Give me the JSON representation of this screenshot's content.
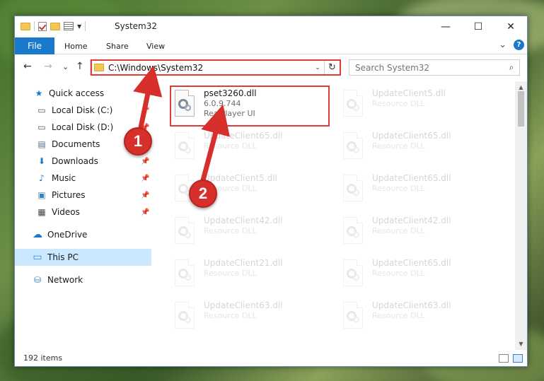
{
  "window": {
    "title": "System32",
    "minimize_glyph": "—",
    "maximize_glyph": "☐",
    "close_glyph": "✕"
  },
  "ribbon": {
    "tabs": [
      "File",
      "Home",
      "Share",
      "View"
    ],
    "expand_glyph": "⌄",
    "help_glyph": "?"
  },
  "navigation": {
    "back_glyph": "←",
    "forward_glyph": "→",
    "recent_glyph": "⌄",
    "up_glyph": "↑",
    "address": "C:\\Windows\\System32",
    "address_dropdown_glyph": "⌄",
    "refresh_glyph": "↻",
    "search_placeholder": "Search System32",
    "search_icon_glyph": "⌕"
  },
  "sidebar": {
    "items": [
      {
        "label": "Quick access",
        "icon": "star-icon",
        "glyph": "★",
        "color": "#1979ca"
      },
      {
        "label": "Local Disk (C:)",
        "icon": "drive-icon",
        "glyph": "▭",
        "color": "#555555"
      },
      {
        "label": "Local Disk (D:)",
        "icon": "drive-icon",
        "glyph": "▭",
        "color": "#555555"
      },
      {
        "label": "Documents",
        "icon": "document-icon",
        "glyph": "▤",
        "color": "#5a6f86"
      },
      {
        "label": "Downloads",
        "icon": "download-icon",
        "glyph": "⬇",
        "color": "#1979ca"
      },
      {
        "label": "Music",
        "icon": "music-icon",
        "glyph": "♪",
        "color": "#1979ca"
      },
      {
        "label": "Pictures",
        "icon": "picture-icon",
        "glyph": "▣",
        "color": "#3c7fb8"
      },
      {
        "label": "Videos",
        "icon": "video-icon",
        "glyph": "▦",
        "color": "#444444"
      },
      {
        "label": "OneDrive",
        "icon": "cloud-icon",
        "glyph": "☁",
        "color": "#1979ca"
      },
      {
        "label": "This PC",
        "icon": "computer-icon",
        "glyph": "▭",
        "color": "#3a8ad6"
      },
      {
        "label": "Network",
        "icon": "network-icon",
        "glyph": "⛁",
        "color": "#3a7fbf"
      }
    ],
    "pin_glyph": "📌"
  },
  "files": {
    "selected": {
      "name": "pset3260.dll",
      "version": "6.0.9.744",
      "description": "RealPlayer UI"
    },
    "faded": [
      {
        "name": "UpdateClient5.dll",
        "description": "Resource DLL"
      },
      {
        "name": "UpdateClient65.dll",
        "description": "Resource DLL"
      },
      {
        "name": "UpdateClient65.dll",
        "description": "Resource DLL"
      },
      {
        "name": "UpdateClient5.dll",
        "description": "Resource DLL"
      },
      {
        "name": "UpdateClient65.dll",
        "description": "Resource DLL"
      },
      {
        "name": "UpdateClient42.dll",
        "description": "Resource DLL"
      },
      {
        "name": "UpdateClient42.dll",
        "description": "Resource DLL"
      },
      {
        "name": "UpdateClient21.dll",
        "description": "Resource DLL"
      },
      {
        "name": "UpdateClient65.dll",
        "description": "Resource DLL"
      },
      {
        "name": "UpdateClient63.dll",
        "description": "Resource DLL"
      },
      {
        "name": "UpdateClient63.dll",
        "description": "Resource DLL"
      }
    ]
  },
  "status": {
    "count": "192 items"
  },
  "annotations": {
    "markers": [
      "1",
      "2"
    ],
    "accent": "#d7302c"
  }
}
